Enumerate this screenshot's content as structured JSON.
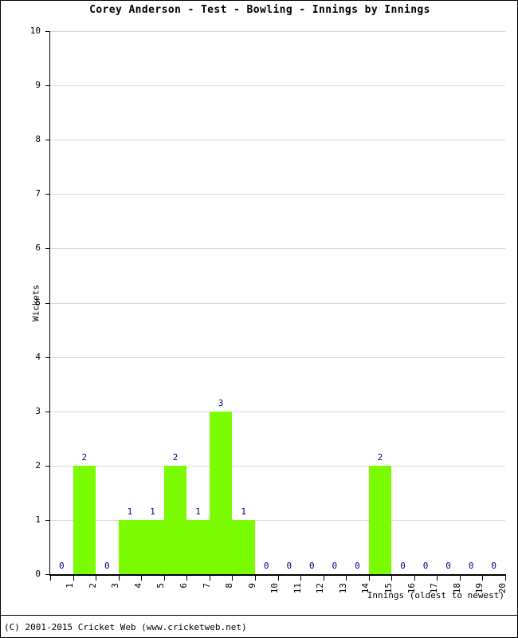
{
  "chart_data": {
    "type": "bar",
    "title": "Corey Anderson - Test - Bowling - Innings by Innings",
    "xlabel": "Innings (oldest to newest)",
    "ylabel": "Wickets",
    "categories": [
      "1",
      "2",
      "3",
      "4",
      "5",
      "6",
      "7",
      "8",
      "9",
      "10",
      "11",
      "12",
      "13",
      "14",
      "15",
      "16",
      "17",
      "18",
      "19",
      "20"
    ],
    "values": [
      0,
      2,
      0,
      1,
      1,
      2,
      1,
      3,
      1,
      0,
      0,
      0,
      0,
      0,
      2,
      0,
      0,
      0,
      0,
      0
    ],
    "ylim": [
      0,
      10
    ],
    "ytick_labels": [
      "0",
      "1",
      "2",
      "3",
      "4",
      "5",
      "6",
      "7",
      "8",
      "9",
      "10"
    ],
    "grid": true,
    "legend": "none",
    "bar_color": "#7CFC00",
    "label_color": "#000080"
  },
  "footer": {
    "copyright": "(C) 2001-2015 Cricket Web (www.cricketweb.net)"
  }
}
